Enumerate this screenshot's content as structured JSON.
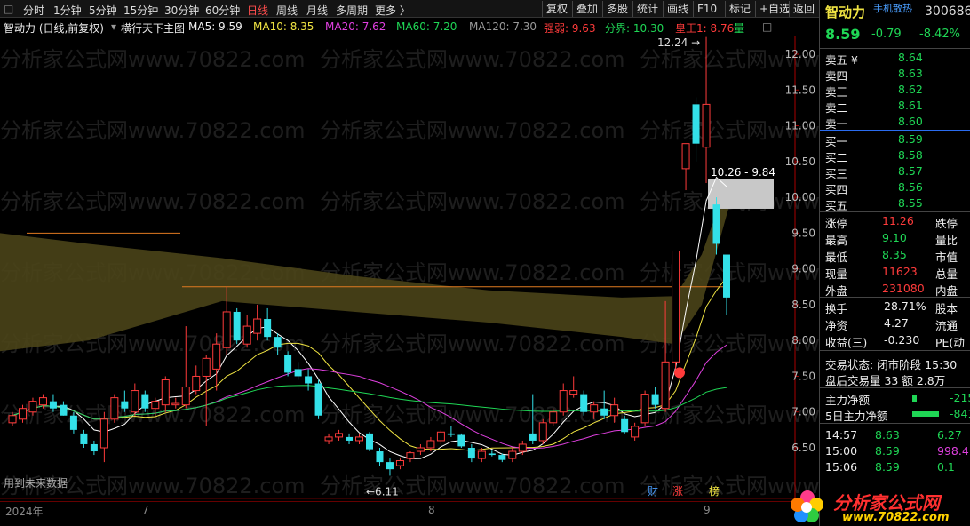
{
  "toolbar": {
    "timeframes": [
      "分时",
      "1分钟",
      "5分钟",
      "15分钟",
      "30分钟",
      "60分钟",
      "日线",
      "周线",
      "月线",
      "多周期",
      "更多 〉"
    ],
    "active_timeframe": "日线",
    "buttons": [
      "复权",
      "叠加",
      "多股",
      "统计",
      "画线",
      "F10",
      "标记",
      "+自选",
      "返回"
    ]
  },
  "ma_bar": {
    "chart_label": "智动力 (日线,前复权)",
    "indicator": "横行天下主图",
    "ma5": "MA5: 9.59",
    "ma10": "MA10: 8.35",
    "ma20": "MA20: 7.62",
    "ma60": "MA60: 7.20",
    "ma120": "MA120: 7.30",
    "qiangruo": "强弱: 9.63",
    "fenjie": "分界: 10.30",
    "huangwang": "皇王1: 8.76",
    "liang": "量"
  },
  "chart_data": {
    "type": "candlestick",
    "y_axis_ticks": [
      "12.00",
      "11.50",
      "11.00",
      "10.50",
      "10.00",
      "9.50",
      "9.00",
      "8.50",
      "8.00",
      "7.50",
      "7.00",
      "6.50"
    ],
    "ylim": [
      6.0,
      12.5
    ],
    "x_labels": [
      "2024年",
      "7",
      "8",
      "9"
    ],
    "annotations": {
      "high": "12.24",
      "low": "←6.11",
      "box_label": "10.26 - 9.84",
      "future_data": "用到未来数据"
    },
    "markers": [
      "财",
      "涨",
      "榜"
    ],
    "candles": [
      {
        "o": 6.85,
        "h": 7.0,
        "l": 6.8,
        "c": 6.95
      },
      {
        "o": 6.9,
        "h": 7.1,
        "l": 6.85,
        "c": 7.05
      },
      {
        "o": 7.0,
        "h": 7.2,
        "l": 6.95,
        "c": 7.15
      },
      {
        "o": 7.1,
        "h": 7.25,
        "l": 7.05,
        "c": 7.2
      },
      {
        "o": 7.15,
        "h": 7.25,
        "l": 7.0,
        "c": 7.05
      },
      {
        "o": 7.1,
        "h": 7.15,
        "l": 6.95,
        "c": 6.95
      },
      {
        "o": 6.95,
        "h": 7.0,
        "l": 6.7,
        "c": 6.75
      },
      {
        "o": 6.7,
        "h": 6.75,
        "l": 6.5,
        "c": 6.55
      },
      {
        "o": 6.55,
        "h": 6.6,
        "l": 6.4,
        "c": 6.45
      },
      {
        "o": 6.5,
        "h": 7.0,
        "l": 6.3,
        "c": 6.9
      },
      {
        "o": 6.9,
        "h": 7.25,
        "l": 6.85,
        "c": 7.2
      },
      {
        "o": 7.15,
        "h": 7.3,
        "l": 7.0,
        "c": 7.05
      },
      {
        "o": 7.0,
        "h": 7.4,
        "l": 6.95,
        "c": 7.3
      },
      {
        "o": 7.25,
        "h": 7.3,
        "l": 7.0,
        "c": 7.05
      },
      {
        "o": 7.05,
        "h": 7.2,
        "l": 6.95,
        "c": 7.15
      },
      {
        "o": 7.1,
        "h": 7.5,
        "l": 7.0,
        "c": 7.45
      },
      {
        "o": 7.1,
        "h": 7.2,
        "l": 7.05,
        "c": 7.12
      },
      {
        "o": 7.1,
        "h": 8.2,
        "l": 7.05,
        "c": 7.35
      },
      {
        "o": 7.3,
        "h": 7.65,
        "l": 7.25,
        "c": 7.5
      },
      {
        "o": 7.5,
        "h": 7.8,
        "l": 6.8,
        "c": 7.75
      },
      {
        "o": 7.6,
        "h": 8.1,
        "l": 7.3,
        "c": 7.95
      },
      {
        "o": 7.9,
        "h": 8.75,
        "l": 7.8,
        "c": 8.4
      },
      {
        "o": 8.4,
        "h": 8.45,
        "l": 7.95,
        "c": 8.0
      },
      {
        "o": 7.95,
        "h": 8.35,
        "l": 7.9,
        "c": 8.2
      },
      {
        "o": 8.1,
        "h": 8.5,
        "l": 8.0,
        "c": 8.3
      },
      {
        "o": 8.3,
        "h": 8.45,
        "l": 8.0,
        "c": 8.05
      },
      {
        "o": 8.05,
        "h": 8.1,
        "l": 7.8,
        "c": 7.9
      },
      {
        "o": 7.8,
        "h": 7.85,
        "l": 7.5,
        "c": 7.55
      },
      {
        "o": 7.6,
        "h": 7.7,
        "l": 7.45,
        "c": 7.5
      },
      {
        "o": 7.5,
        "h": 7.6,
        "l": 7.3,
        "c": 7.4
      },
      {
        "o": 7.4,
        "h": 7.45,
        "l": 6.9,
        "c": 6.95
      },
      {
        "o": 6.6,
        "h": 6.7,
        "l": 6.55,
        "c": 6.65
      },
      {
        "o": 6.65,
        "h": 6.75,
        "l": 6.6,
        "c": 6.7
      },
      {
        "o": 6.65,
        "h": 6.7,
        "l": 6.55,
        "c": 6.6
      },
      {
        "o": 6.6,
        "h": 6.7,
        "l": 6.55,
        "c": 6.65
      },
      {
        "o": 6.7,
        "h": 6.72,
        "l": 6.45,
        "c": 6.48
      },
      {
        "o": 6.45,
        "h": 6.5,
        "l": 6.25,
        "c": 6.3
      },
      {
        "o": 6.3,
        "h": 6.35,
        "l": 6.11,
        "c": 6.2
      },
      {
        "o": 6.25,
        "h": 6.35,
        "l": 6.2,
        "c": 6.32
      },
      {
        "o": 6.35,
        "h": 6.45,
        "l": 6.3,
        "c": 6.43
      },
      {
        "o": 6.45,
        "h": 6.55,
        "l": 6.4,
        "c": 6.5
      },
      {
        "o": 6.5,
        "h": 6.65,
        "l": 6.45,
        "c": 6.6
      },
      {
        "o": 6.6,
        "h": 6.75,
        "l": 6.55,
        "c": 6.72
      },
      {
        "o": 6.7,
        "h": 6.8,
        "l": 6.65,
        "c": 6.68
      },
      {
        "o": 6.68,
        "h": 6.7,
        "l": 6.5,
        "c": 6.52
      },
      {
        "o": 6.5,
        "h": 6.55,
        "l": 6.3,
        "c": 6.35
      },
      {
        "o": 6.35,
        "h": 6.5,
        "l": 6.3,
        "c": 6.45
      },
      {
        "o": 6.42,
        "h": 6.46,
        "l": 6.38,
        "c": 6.4
      },
      {
        "o": 6.4,
        "h": 6.42,
        "l": 6.3,
        "c": 6.33
      },
      {
        "o": 6.35,
        "h": 6.5,
        "l": 6.3,
        "c": 6.45
      },
      {
        "o": 6.45,
        "h": 6.6,
        "l": 6.4,
        "c": 6.55
      },
      {
        "o": 6.7,
        "h": 7.25,
        "l": 6.55,
        "c": 6.6
      },
      {
        "o": 6.6,
        "h": 6.9,
        "l": 6.55,
        "c": 6.85
      },
      {
        "o": 6.85,
        "h": 7.05,
        "l": 6.8,
        "c": 7.0
      },
      {
        "o": 7.0,
        "h": 7.4,
        "l": 6.95,
        "c": 7.3
      },
      {
        "o": 7.25,
        "h": 7.5,
        "l": 7.2,
        "c": 7.3
      },
      {
        "o": 7.25,
        "h": 7.3,
        "l": 6.95,
        "c": 7.0
      },
      {
        "o": 7.0,
        "h": 7.15,
        "l": 6.9,
        "c": 7.1
      },
      {
        "o": 7.05,
        "h": 7.3,
        "l": 6.9,
        "c": 6.95
      },
      {
        "o": 6.95,
        "h": 7.2,
        "l": 6.85,
        "c": 7.1
      },
      {
        "o": 6.9,
        "h": 6.95,
        "l": 6.7,
        "c": 6.72
      },
      {
        "o": 6.65,
        "h": 6.85,
        "l": 6.6,
        "c": 6.8
      },
      {
        "o": 6.85,
        "h": 7.3,
        "l": 6.8,
        "c": 7.25
      },
      {
        "o": 7.25,
        "h": 7.35,
        "l": 7.05,
        "c": 7.1
      },
      {
        "o": 7.05,
        "h": 8.55,
        "l": 7.0,
        "c": 7.7
      },
      {
        "o": 7.7,
        "h": 9.25,
        "l": 7.6,
        "c": 9.25
      },
      {
        "o": 10.4,
        "h": 10.75,
        "l": 10.1,
        "c": 10.75
      },
      {
        "o": 11.3,
        "h": 11.4,
        "l": 10.5,
        "c": 10.75
      },
      {
        "o": 10.7,
        "h": 12.24,
        "l": 10.2,
        "c": 11.3
      },
      {
        "o": 9.9,
        "h": 10.0,
        "l": 9.2,
        "c": 9.35
      },
      {
        "o": 9.2,
        "h": 9.1,
        "l": 8.35,
        "c": 8.6
      }
    ]
  },
  "panel": {
    "name": "智动力",
    "tag": "手机散热",
    "code": "300686",
    "price": "8.59",
    "change": "-0.79",
    "pct": "-8.42%",
    "asks": [
      {
        "label": "卖五 ¥",
        "price": "8.64"
      },
      {
        "label": "卖四",
        "price": "8.63"
      },
      {
        "label": "卖三",
        "price": "8.62"
      },
      {
        "label": "卖二",
        "price": "8.61"
      },
      {
        "label": "卖一",
        "price": "8.60"
      }
    ],
    "bids": [
      {
        "label": "买一",
        "price": "8.59"
      },
      {
        "label": "买二",
        "price": "8.58"
      },
      {
        "label": "买三",
        "price": "8.57"
      },
      {
        "label": "买四",
        "price": "8.56"
      },
      {
        "label": "买五",
        "price": "8.55"
      }
    ],
    "stats": [
      {
        "k": "涨停",
        "v": "11.26",
        "k2": "跌停"
      },
      {
        "k": "最高",
        "v": "9.10",
        "k2": "量比"
      },
      {
        "k": "最低",
        "v": "8.35",
        "k2": "市值"
      },
      {
        "k": "现量",
        "v": "11623",
        "k2": "总量"
      },
      {
        "k": "外盘",
        "v": "231080",
        "k2": "内盘"
      }
    ],
    "stats2": [
      {
        "k": "换手",
        "v": "28.71%",
        "k2": "股本"
      },
      {
        "k": "净资",
        "v": "4.27",
        "k2": "流通"
      },
      {
        "k": "收益(三)",
        "v": "-0.230",
        "k2": "PE(动"
      }
    ],
    "trade_status": "交易状态: 闭市阶段 15:30",
    "after_hours": "盘后交易量 33 额 2.8万",
    "net_main_label": "主力净额",
    "net_main_val": "-215",
    "net5_label": "5日主力净额",
    "net5_val": "-841",
    "ticks": [
      {
        "t": "14:57",
        "p": "8.63",
        "v": "6.27"
      },
      {
        "t": "15:00",
        "p": "8.59",
        "v": "998.4"
      },
      {
        "t": "15:06",
        "p": "8.59",
        "v": "0.1"
      }
    ]
  },
  "watermark": "分析家公式网www.70822.com",
  "logo": {
    "title": "分析家公式网",
    "url": "www.70822.com"
  },
  "colors": {
    "up": "#ff3b3b",
    "down": "#33e0e8",
    "ma5": "#ffffff",
    "ma10": "#f0e442",
    "ma20": "#e040e0",
    "ma60": "#1fd655",
    "band": "#4a4418"
  }
}
